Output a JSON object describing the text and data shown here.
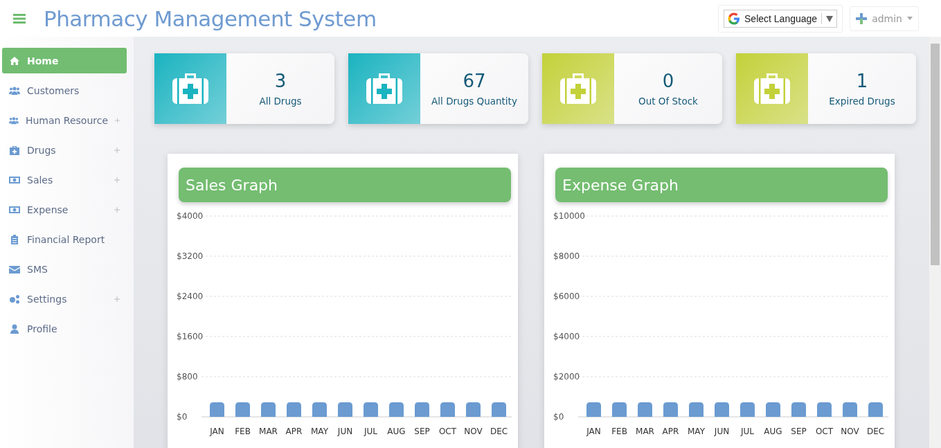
{
  "header": {
    "title": "Pharmacy Management System",
    "language": "Select Language",
    "user": "admin"
  },
  "sidebar": {
    "items": [
      {
        "label": "Home",
        "selected": true,
        "expandable": false
      },
      {
        "label": "Customers",
        "selected": false,
        "expandable": false
      },
      {
        "label": "Human Resource",
        "selected": false,
        "expandable": true
      },
      {
        "label": "Drugs",
        "selected": false,
        "expandable": true
      },
      {
        "label": "Sales",
        "selected": false,
        "expandable": true
      },
      {
        "label": "Expense",
        "selected": false,
        "expandable": true
      },
      {
        "label": "Financial Report",
        "selected": false,
        "expandable": false
      },
      {
        "label": "SMS",
        "selected": false,
        "expandable": false
      },
      {
        "label": "Settings",
        "selected": false,
        "expandable": true
      },
      {
        "label": "Profile",
        "selected": false,
        "expandable": false
      }
    ]
  },
  "stats": [
    {
      "value": "3",
      "label": "All Drugs",
      "color": "#1ab3c0"
    },
    {
      "value": "67",
      "label": "All Drugs Quantity",
      "color": "#1ab3c0"
    },
    {
      "value": "0",
      "label": "Out Of Stock",
      "color": "#c3d13a"
    },
    {
      "value": "1",
      "label": "Expired Drugs",
      "color": "#c3d13a"
    }
  ],
  "charts": [
    {
      "title": "Sales Graph",
      "chart_data": {
        "type": "bar",
        "categories": [
          "JAN",
          "FEB",
          "MAR",
          "APR",
          "MAY",
          "JUN",
          "JUL",
          "AUG",
          "SEP",
          "OCT",
          "NOV",
          "DEC"
        ],
        "grid": true,
        "series": [
          {
            "color": "#6b9bd1",
            "values": [
              290,
              290,
              290,
              290,
              290,
              290,
              290,
              290,
              290,
              290,
              290,
              290
            ]
          }
        ],
        "ylim": [
          0,
          4000
        ],
        "yticks": [
          {
            "value": 0,
            "label": "$0"
          },
          {
            "value": 800,
            "label": "$800"
          },
          {
            "value": 1600,
            "label": "$1600"
          },
          {
            "value": 2400,
            "label": "$2400"
          },
          {
            "value": 3200,
            "label": "$3200"
          },
          {
            "value": 4000,
            "label": "$4000"
          }
        ]
      }
    },
    {
      "title": "Expense Graph",
      "chart_data": {
        "type": "bar",
        "categories": [
          "JAN",
          "FEB",
          "MAR",
          "APR",
          "MAY",
          "JUN",
          "JUL",
          "AUG",
          "SEP",
          "OCT",
          "NOV",
          "DEC"
        ],
        "grid": true,
        "series": [
          {
            "color": "#6b9bd1",
            "values": [
              720,
              720,
              720,
              720,
              720,
              720,
              720,
              720,
              720,
              720,
              720,
              720
            ]
          }
        ],
        "ylim": [
          0,
          10000
        ],
        "yticks": [
          {
            "value": 0,
            "label": "$0"
          },
          {
            "value": 2000,
            "label": "$2000"
          },
          {
            "value": 4000,
            "label": "$4000"
          },
          {
            "value": 6000,
            "label": "$6000"
          },
          {
            "value": 8000,
            "label": "$8000"
          },
          {
            "value": 10000,
            "label": "$10000"
          }
        ]
      }
    }
  ]
}
